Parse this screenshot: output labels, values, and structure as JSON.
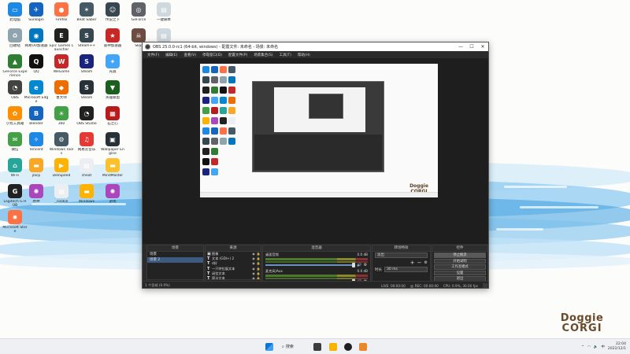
{
  "desktop": {
    "icons": [
      {
        "label": "此电脑",
        "color": "#1e88e5",
        "glyph": "▭"
      },
      {
        "label": "Sunlogin",
        "color": "#1565c0",
        "glyph": "✈"
      },
      {
        "label": "Firefox",
        "color": "#ff7043",
        "glyph": "●"
      },
      {
        "label": "Beat Saber",
        "color": "#455a64",
        "glyph": "✶"
      },
      {
        "label": "传说之下",
        "color": "#37474f",
        "glyph": "☺"
      },
      {
        "label": "GeForce",
        "color": "#5f6368",
        "glyph": "◎"
      },
      {
        "label": "一键脚本",
        "color": "#cfd8dc",
        "glyph": "▤"
      },
      {
        "label": "回收站",
        "color": "#90a4ae",
        "glyph": "♻"
      },
      {
        "label": "网易UU加速器",
        "color": "#0277bd",
        "glyph": "◉"
      },
      {
        "label": "Epic Games Launcher",
        "color": "#212121",
        "glyph": "E"
      },
      {
        "label": "Steam++",
        "color": "#37474f",
        "glyph": "S"
      },
      {
        "label": "雷神加速器",
        "color": "#c62828",
        "glyph": "★"
      },
      {
        "label": "Skul",
        "color": "#6d4c41",
        "glyph": "☠"
      },
      {
        "label": "新建文本",
        "color": "#cfd8dc",
        "glyph": "▤"
      },
      {
        "label": "GeForce Experience",
        "color": "#2e7d32",
        "glyph": "▲"
      },
      {
        "label": "QQ",
        "color": "#111111",
        "glyph": "Q"
      },
      {
        "label": "WeGame",
        "color": "#c62828",
        "glyph": "W"
      },
      {
        "label": "Steam",
        "color": "#1a237e",
        "glyph": "S"
      },
      {
        "label": "光遇",
        "color": "#42a5f5",
        "glyph": "✦"
      },
      {
        "label": "OBS",
        "color": "#424242",
        "glyph": "◔"
      },
      {
        "label": "Microsoft Edge",
        "color": "#0288d1",
        "glyph": "e"
      },
      {
        "label": "鲁大师",
        "color": "#ef6c00",
        "glyph": "◆"
      },
      {
        "label": "Steam",
        "color": "#263238",
        "glyph": "S"
      },
      {
        "label": "英雄联盟",
        "color": "#1b5e20",
        "glyph": "▼"
      },
      {
        "label": "小丸工具箱",
        "color": "#ff8f00",
        "glyph": "✿"
      },
      {
        "label": "Blender",
        "color": "#1565c0",
        "glyph": "B"
      },
      {
        "label": "360",
        "color": "#43a047",
        "glyph": "☀"
      },
      {
        "label": "OBS Studio",
        "color": "#212121",
        "glyph": "◔"
      },
      {
        "label": "石之心",
        "color": "#b71c1c",
        "glyph": "▦"
      },
      {
        "label": "微信",
        "color": "#43a047",
        "glyph": "✉"
      },
      {
        "label": "Tencent",
        "color": "#1e88e5",
        "glyph": "✧"
      },
      {
        "label": "Windows Tools",
        "color": "#455a64",
        "glyph": "⚙"
      },
      {
        "label": "网易云音乐",
        "color": "#e53935",
        "glyph": "♫"
      },
      {
        "label": "Wallpaper Engine",
        "color": "#263238",
        "glyph": "▣"
      },
      {
        "label": "Wi-Fi",
        "color": "#26a69a",
        "glyph": "⌂"
      },
      {
        "label": "jlacp",
        "color": "#f9a825",
        "glyph": "▬"
      },
      {
        "label": "DeliSpeed",
        "color": "#ffb300",
        "glyph": "▶"
      },
      {
        "label": "cheat",
        "color": "#eceff1",
        "glyph": "▤"
      },
      {
        "label": "MindMaster",
        "color": "#fbc02d",
        "glyph": "▬"
      },
      {
        "label": "Logitech G HUB",
        "color": "#212121",
        "glyph": "G"
      },
      {
        "label": "原神",
        "color": "#ab47bc",
        "glyph": "✺"
      },
      {
        "label": "_cookie",
        "color": "#eceff1",
        "glyph": "▤"
      },
      {
        "label": "Windows",
        "color": "#ffb300",
        "glyph": "▬"
      },
      {
        "label": "游戏",
        "color": "#ab47bc",
        "glyph": "✺"
      },
      {
        "label": "Microsoft Store",
        "color": "#ff7043",
        "glyph": "✹"
      }
    ]
  },
  "obs": {
    "title": "OBS 25.0.0-rc1 (64-bit, windows) - 配置文件: 未命名 - 场景: 未命名",
    "window_buttons": [
      "—",
      "☐",
      "✕"
    ],
    "menu": [
      "文件(F)",
      "编辑(E)",
      "查看(V)",
      "停靠窗口(D)",
      "配置文件(P)",
      "场景集合(S)",
      "工具(T)",
      "帮助(H)"
    ],
    "preview_logo": [
      "Doggie",
      "CORGI"
    ],
    "scenes": {
      "title": "场景",
      "items": [
        "场景",
        "场景 2"
      ],
      "selected": 1
    },
    "sources": {
      "title": "来源",
      "items": [
        {
          "icon": "▣",
          "name": "图像"
        },
        {
          "icon": "T",
          "name": "文本 (GDI+) 2"
        },
        {
          "icon": "T",
          "name": "d好"
        },
        {
          "icon": "T",
          "name": "一只特拉展文本"
        },
        {
          "icon": "T",
          "name": "闭信文本"
        },
        {
          "icon": "T",
          "name": "简洁文本"
        },
        {
          "icon": "▣",
          "name": "显示器捕获 2"
        },
        {
          "icon": "▣",
          "name": "背景资源"
        }
      ]
    },
    "mixer": {
      "title": "混音器",
      "channels": [
        {
          "name": "桌面音频",
          "db": "0.0 dB"
        },
        {
          "name": "麦克风/Aux",
          "db": "0.0 dB"
        }
      ]
    },
    "transitions": {
      "title": "转场特效",
      "type": "淡出",
      "duration_label": "时长",
      "duration": "30 ms"
    },
    "controls": {
      "title": "控件",
      "buttons": [
        "停止推流",
        "开始录制",
        "工作室模式",
        "设置",
        "退出"
      ],
      "active": 0
    },
    "status": {
      "left": "1 个丢帧 (0.0%)",
      "live_label": "LIVE:",
      "live_time": "00:00:00",
      "rec_label": "REC:",
      "rec_time": "00:00:00",
      "cpu": "CPU: 0.9%, 30.00 fps"
    }
  },
  "wallpaper": {
    "logo_line1": "Doggie",
    "logo_line2": "CORGI"
  },
  "taskbar": {
    "search_label": "搜索",
    "time": "22:04",
    "date": "2022/12/1",
    "tray_chevron": "^",
    "tray_lang": "中"
  }
}
